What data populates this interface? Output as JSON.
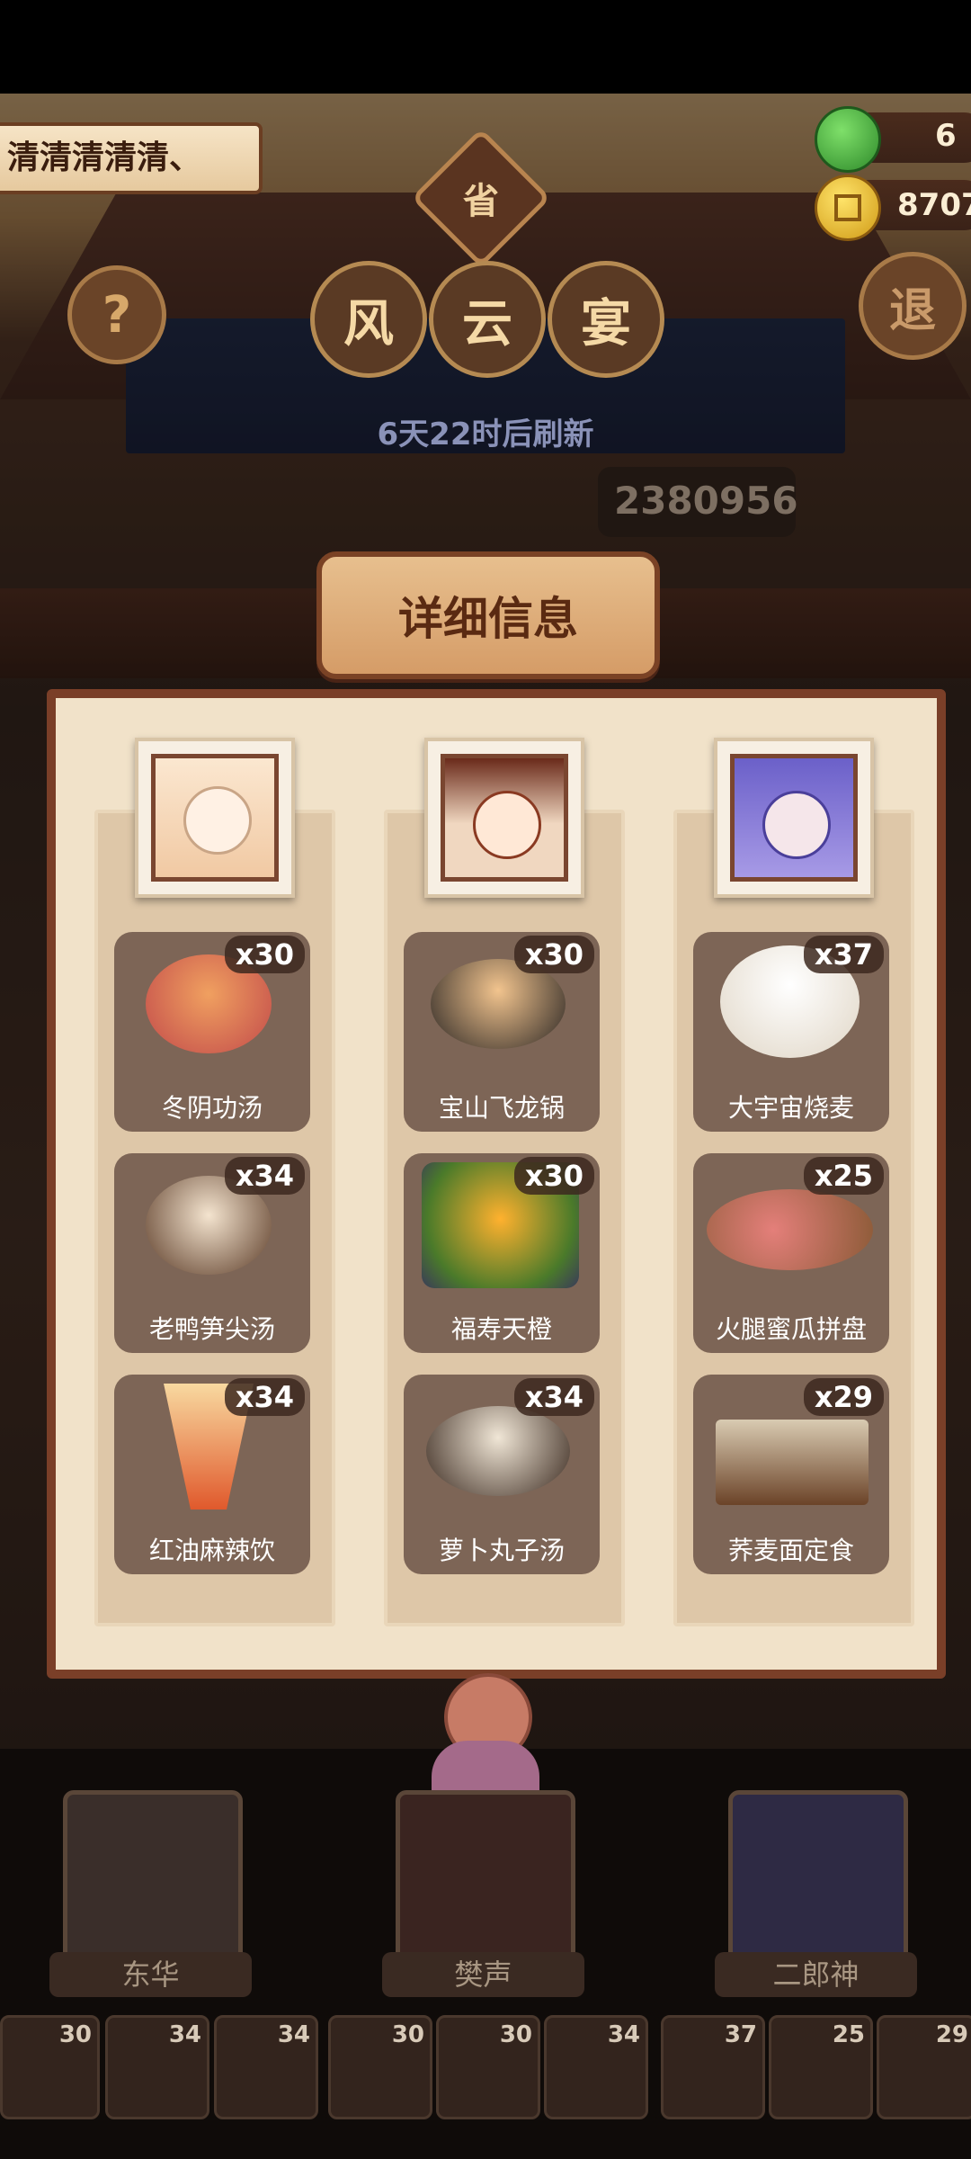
{
  "header": {
    "player_name": "清清清清清、",
    "title_chars": [
      "风",
      "云",
      "宴"
    ],
    "title_badge": "省",
    "refresh_text": "6天22时后刷新",
    "score": "2380956",
    "currency_green": "6",
    "currency_gold": "8707",
    "help_label": "?",
    "exit_label": "退"
  },
  "dialog": {
    "title": "详细信息",
    "columns": [
      {
        "character": "东华",
        "dishes": [
          {
            "name": "冬阴功汤",
            "count": "x30",
            "icon": "tom-yum-soup-icon"
          },
          {
            "name": "老鸭笋尖汤",
            "count": "x34",
            "icon": "duck-soup-icon"
          },
          {
            "name": "红油麻辣饮",
            "count": "x34",
            "icon": "spicy-drink-icon"
          }
        ]
      },
      {
        "character": "樊声",
        "dishes": [
          {
            "name": "宝山飞龙锅",
            "count": "x30",
            "icon": "hotpot-icon"
          },
          {
            "name": "福寿天橙",
            "count": "x30",
            "icon": "orange-platter-icon"
          },
          {
            "name": "萝卜丸子汤",
            "count": "x34",
            "icon": "meatball-soup-icon"
          }
        ]
      },
      {
        "character": "二郎神",
        "dishes": [
          {
            "name": "大宇宙烧麦",
            "count": "x37",
            "icon": "shaomai-icon"
          },
          {
            "name": "火腿蜜瓜拼盘",
            "count": "x25",
            "icon": "ham-melon-icon"
          },
          {
            "name": "荞麦面定食",
            "count": "x29",
            "icon": "soba-set-icon"
          }
        ]
      }
    ]
  },
  "bottom": {
    "characters": [
      "东华",
      "樊声",
      "二郎神"
    ],
    "strip_counts": [
      "30",
      "34",
      "34",
      "30",
      "30",
      "34",
      "37",
      "25",
      "29"
    ]
  },
  "colors": {
    "panel_bg": "#f1e2c9",
    "frame": "#7a3f28",
    "card": "#7d6556",
    "plaque": "#d59c67"
  }
}
